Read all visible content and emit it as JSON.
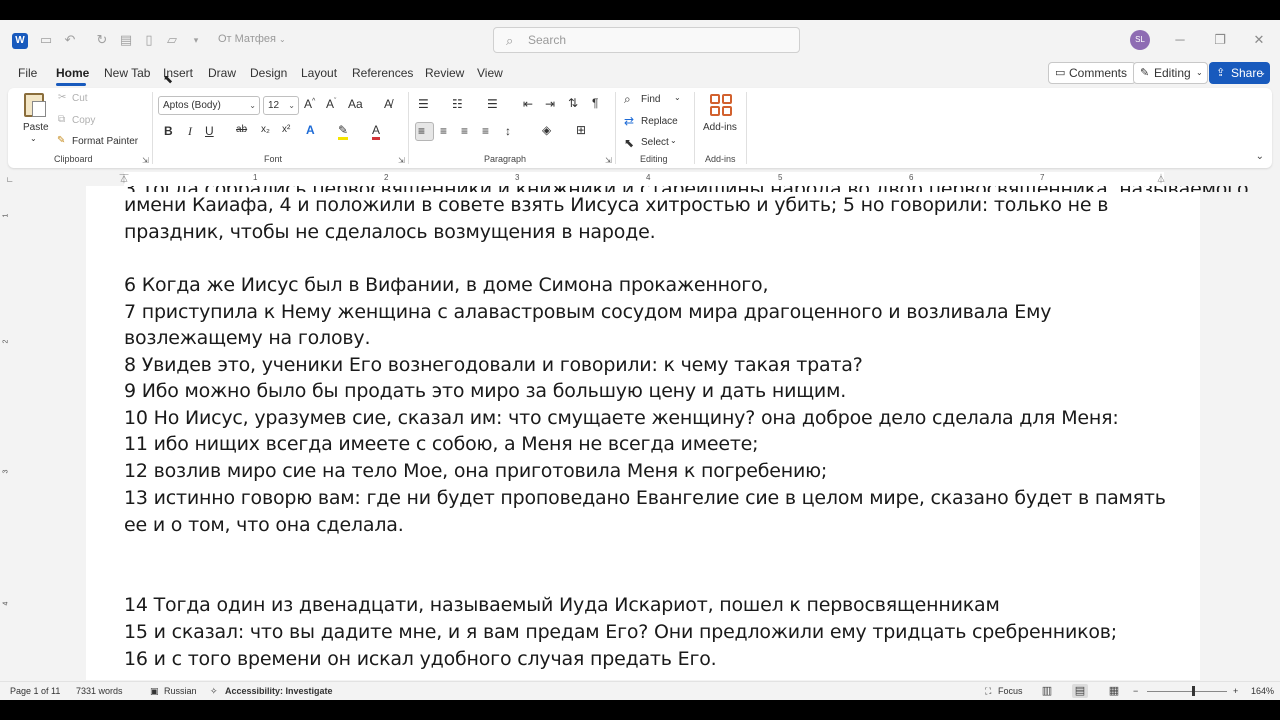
{
  "titlebar": {
    "doc_title": "От Матфея",
    "search_placeholder": "Search",
    "avatar_initials": "SL",
    "word_logo_letter": "W"
  },
  "tabs": [
    "File",
    "Home",
    "New Tab",
    "Insert",
    "Draw",
    "Design",
    "Layout",
    "References",
    "Review",
    "View"
  ],
  "actions": {
    "comments": "Comments",
    "editing": "Editing",
    "share": "Share"
  },
  "ribbon": {
    "clipboard": {
      "label": "Clipboard",
      "paste": "Paste",
      "cut": "Cut",
      "copy": "Copy",
      "format_painter": "Format Painter"
    },
    "font": {
      "label": "Font",
      "family": "Aptos (Body)",
      "size": "12"
    },
    "paragraph": {
      "label": "Paragraph"
    },
    "editing": {
      "label": "Editing",
      "find": "Find",
      "replace": "Replace",
      "select": "Select"
    },
    "addins": {
      "label": "Add-ins",
      "button": "Add-ins"
    }
  },
  "ruler": {
    "numbers": [
      "1",
      "2",
      "3",
      "4",
      "5",
      "6",
      "7"
    ]
  },
  "vruler": {
    "numbers": [
      "1",
      "2",
      "3",
      "4"
    ]
  },
  "document": {
    "lines": [
      "имени Каиафа, 4 и положили в совете взять Иисуса хитростью и убить; 5 но говорили: только не в",
      "праздник, чтобы не сделалось возмущения в народе.",
      "",
      "6 Когда же Иисус был в Вифании, в доме Симона прокаженного,",
      "7 приступила к Нему женщина с алавастровым сосудом мира драгоценного и возливала Ему",
      "возлежащему на голову.",
      "8 Увидев это, ученики Его вознегодовали и говорили: к чему такая трата?",
      "9 Ибо можно было бы продать это миро за большую цену и дать нищим.",
      "10 Но Иисус, уразумев сие, сказал им: что смущаете женщину? она доброе дело сделала для Меня:",
      "11 ибо нищих всегда имеете с собою, а Меня не всегда имеете;",
      "12 возлив миро сие на тело Мое, она приготовила Меня к погребению;",
      "13 истинно говорю вам: где ни будет проповедано Евангелие сие в целом мире, сказано будет в память",
      "ее и о том, что она сделала.",
      "",
      "",
      "14 Тогда один из двенадцати, называемый Иуда Искариот, пошел к первосвященникам",
      "15 и сказал: что вы дадите мне, и я вам предам Его? Они предложили ему тридцать сребренников;",
      "16 и с того времени он искал удобного случая предать Его."
    ]
  },
  "statusbar": {
    "page": "Page 1 of 11",
    "words": "7331 words",
    "language": "Russian",
    "accessibility": "Accessibility: Investigate",
    "focus": "Focus",
    "zoom": "164%"
  }
}
